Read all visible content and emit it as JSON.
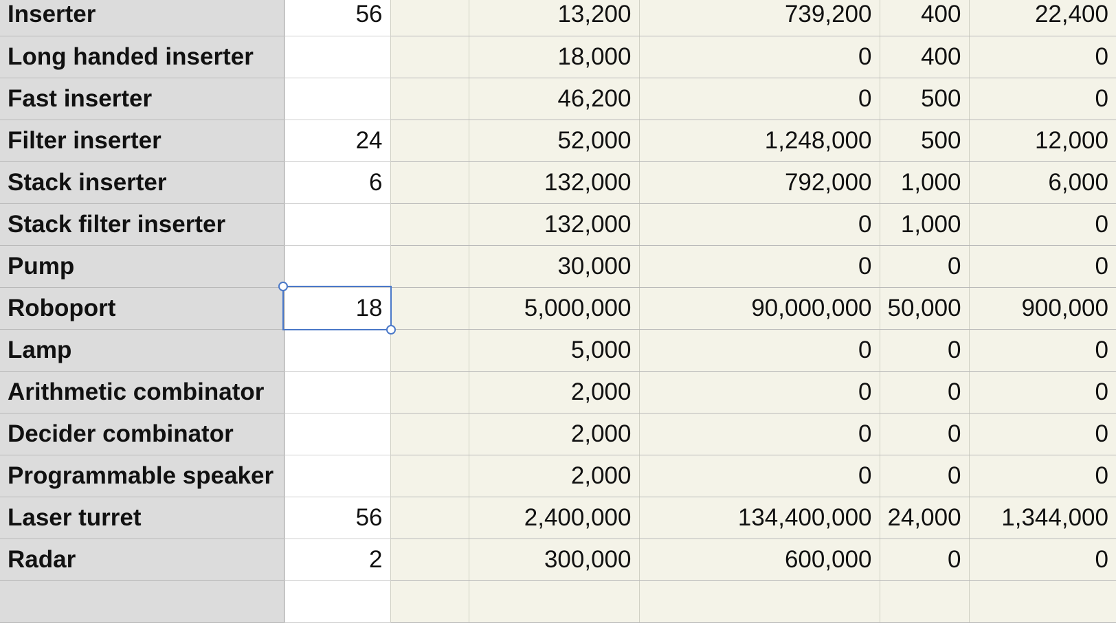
{
  "rows": [
    {
      "name": "Inserter",
      "count": "56",
      "c3": "",
      "c4": "13,200",
      "c5": "739,200",
      "c6": "400",
      "c7": "22,400"
    },
    {
      "name": "Long handed inserter",
      "count": "",
      "c3": "",
      "c4": "18,000",
      "c5": "0",
      "c6": "400",
      "c7": "0"
    },
    {
      "name": "Fast inserter",
      "count": "",
      "c3": "",
      "c4": "46,200",
      "c5": "0",
      "c6": "500",
      "c7": "0"
    },
    {
      "name": "Filter inserter",
      "count": "24",
      "c3": "",
      "c4": "52,000",
      "c5": "1,248,000",
      "c6": "500",
      "c7": "12,000"
    },
    {
      "name": "Stack inserter",
      "count": "6",
      "c3": "",
      "c4": "132,000",
      "c5": "792,000",
      "c6": "1,000",
      "c7": "6,000"
    },
    {
      "name": "Stack filter inserter",
      "count": "",
      "c3": "",
      "c4": "132,000",
      "c5": "0",
      "c6": "1,000",
      "c7": "0"
    },
    {
      "name": "Pump",
      "count": "",
      "c3": "",
      "c4": "30,000",
      "c5": "0",
      "c6": "0",
      "c7": "0"
    },
    {
      "name": "Roboport",
      "count": "18",
      "c3": "",
      "c4": "5,000,000",
      "c5": "90,000,000",
      "c6": "50,000",
      "c7": "900,000"
    },
    {
      "name": "Lamp",
      "count": "",
      "c3": "",
      "c4": "5,000",
      "c5": "0",
      "c6": "0",
      "c7": "0"
    },
    {
      "name": "Arithmetic combinator",
      "count": "",
      "c3": "",
      "c4": "2,000",
      "c5": "0",
      "c6": "0",
      "c7": "0"
    },
    {
      "name": "Decider combinator",
      "count": "",
      "c3": "",
      "c4": "2,000",
      "c5": "0",
      "c6": "0",
      "c7": "0"
    },
    {
      "name": "Programmable speaker",
      "count": "",
      "c3": "",
      "c4": "2,000",
      "c5": "0",
      "c6": "0",
      "c7": "0"
    },
    {
      "name": "Laser turret",
      "count": "56",
      "c3": "",
      "c4": "2,400,000",
      "c5": "134,400,000",
      "c6": "24,000",
      "c7": "1,344,000"
    },
    {
      "name": "Radar",
      "count": "2",
      "c3": "",
      "c4": "300,000",
      "c5": "600,000",
      "c6": "0",
      "c7": "0"
    },
    {
      "name": "",
      "count": "",
      "c3": "",
      "c4": "",
      "c5": "",
      "c6": "",
      "c7": ""
    }
  ],
  "selection": {
    "row": 7,
    "col": "count"
  },
  "colors": {
    "header_column_bg": "#dcdcdc",
    "input_column_bg": "#ffffff",
    "computed_bg": "#f4f3e8",
    "selection": "#4a78c8",
    "grid_line": "#b9b9b9"
  }
}
